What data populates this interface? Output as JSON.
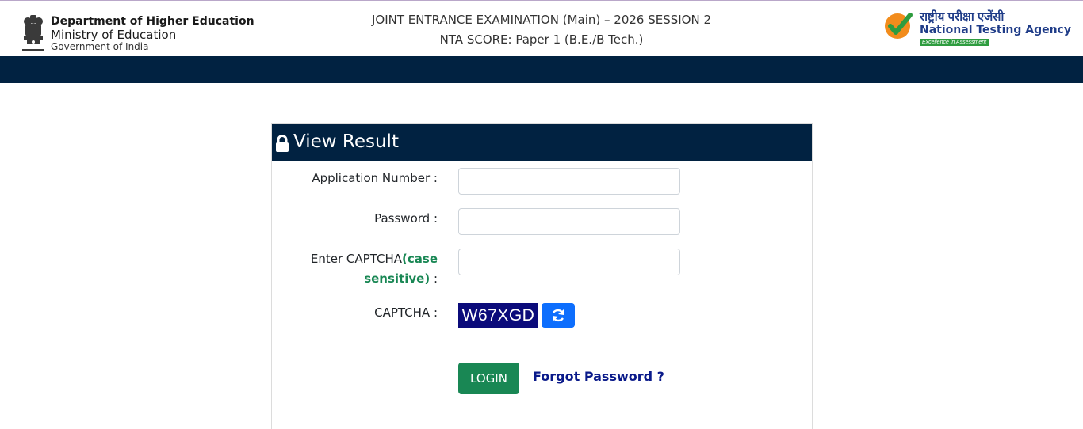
{
  "header": {
    "dept_line1": "Department of Higher Education",
    "dept_line2": "Ministry of Education",
    "dept_line3": "Government of India",
    "exam_line1": "JOINT ENTRANCE EXAMINATION (Main) – 2026 SESSION 2",
    "exam_line2": "NTA SCORE: Paper 1 (B.E./B Tech.)",
    "nta_hindi": "राष्ट्रीय परीक्षा एजेंसी",
    "nta_name": "National Testing Agency",
    "nta_tagline": "Excellence in Assessment"
  },
  "card": {
    "title": "View Result",
    "application_label": "Application Number :",
    "application_value": "",
    "password_label": "Password :",
    "password_value": "",
    "captcha_input_label_part1": "Enter CAPTCHA",
    "captcha_input_label_part2": "(case",
    "captcha_input_label_part3": "sensitive)",
    "captcha_input_label_part4": " :",
    "captcha_input_value": "",
    "captcha_label": "CAPTCHA :",
    "captcha_text": "W67XGD",
    "login_label": "LOGIN",
    "forgot_label": "Forgot Password ?"
  },
  "icons": {
    "emblem": "national-emblem-icon",
    "nta_logo": "nta-check-logo-icon",
    "lock": "lock-icon",
    "refresh": "refresh-icon"
  },
  "colors": {
    "navbar": "#012241",
    "login_button": "#198754",
    "refresh_button": "#0d6efd",
    "captcha_bg": "#0b0b7a",
    "case_sensitive_text": "#198754",
    "link": "#0a1a8a"
  }
}
